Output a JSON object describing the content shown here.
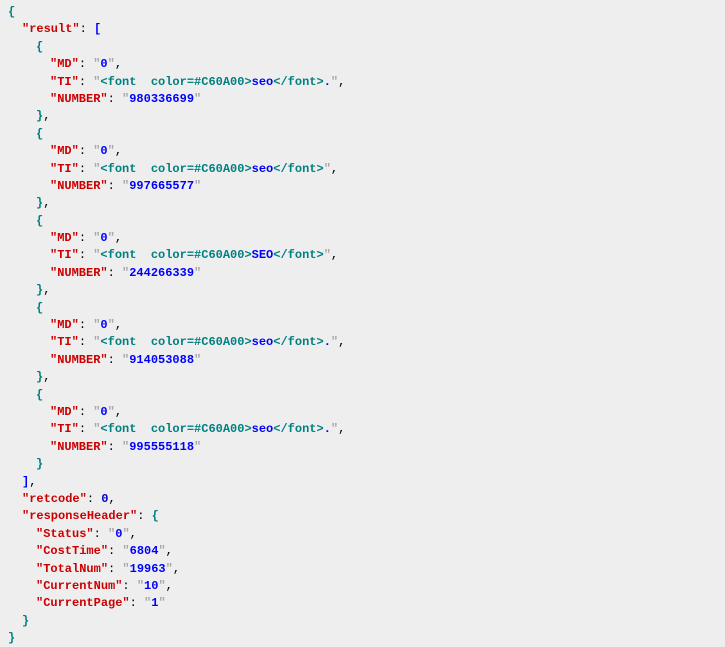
{
  "root_key": "result",
  "items": [
    {
      "MD": "0",
      "TI_open": "<font  color=#C60A00>",
      "TI_text": "seo",
      "TI_close": "</font>",
      "TI_suffix": ".",
      "NUMBER": "980336699"
    },
    {
      "MD": "0",
      "TI_open": "<font  color=#C60A00>",
      "TI_text": "seo",
      "TI_close": "</font>",
      "TI_suffix": "",
      "NUMBER": "997665577"
    },
    {
      "MD": "0",
      "TI_open": "<font  color=#C60A00>",
      "TI_text": "SEO",
      "TI_close": "</font>",
      "TI_suffix": "",
      "NUMBER": "244266339"
    },
    {
      "MD": "0",
      "TI_open": "<font  color=#C60A00>",
      "TI_text": "seo",
      "TI_close": "</font>",
      "TI_suffix": ".",
      "NUMBER": "914053088"
    },
    {
      "MD": "0",
      "TI_open": "<font  color=#C60A00>",
      "TI_text": "seo",
      "TI_close": "</font>",
      "TI_suffix": ".",
      "NUMBER": "995555118"
    }
  ],
  "keys": {
    "MD": "MD",
    "TI": "TI",
    "NUMBER": "NUMBER"
  },
  "retcode_key": "retcode",
  "retcode_val": "0",
  "responseHeader_key": "responseHeader",
  "responseHeader": {
    "Status": {
      "k": "Status",
      "v": "0"
    },
    "CostTime": {
      "k": "CostTime",
      "v": "6804"
    },
    "TotalNum": {
      "k": "TotalNum",
      "v": "19963"
    },
    "CurrentNum": {
      "k": "CurrentNum",
      "v": "10"
    },
    "CurrentPage": {
      "k": "CurrentPage",
      "v": "1"
    }
  }
}
